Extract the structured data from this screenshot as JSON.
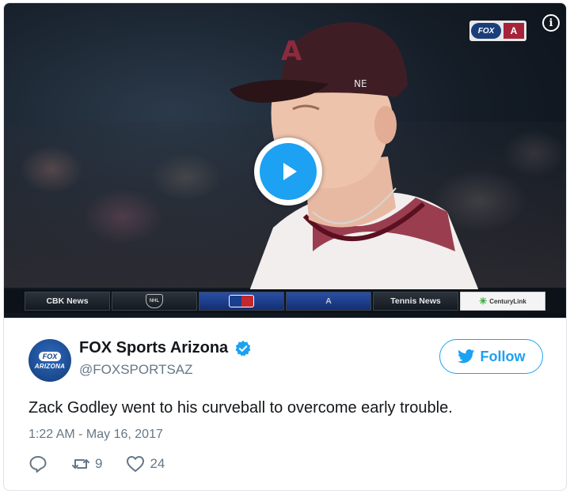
{
  "video": {
    "ticker": [
      "CBK News",
      "NHL",
      "",
      "",
      "Tennis News",
      "CenturyLink"
    ],
    "network_bug": "FOX SPORTS",
    "info_icon": "info-icon",
    "play_icon": "play-icon"
  },
  "tweet": {
    "avatar_text_1": "FOX",
    "avatar_text_2": "ARIZONA",
    "display_name": "FOX Sports Arizona",
    "handle": "@FOXSPORTSAZ",
    "follow_label": "Follow",
    "text": "Zack Godley went to his curveball to overcome early trouble.",
    "timestamp": "1:22 AM - May 16, 2017",
    "retweets": "9",
    "likes": "24"
  },
  "colors": {
    "accent": "#1da1f2",
    "text": "#14171a",
    "muted": "#657786"
  }
}
